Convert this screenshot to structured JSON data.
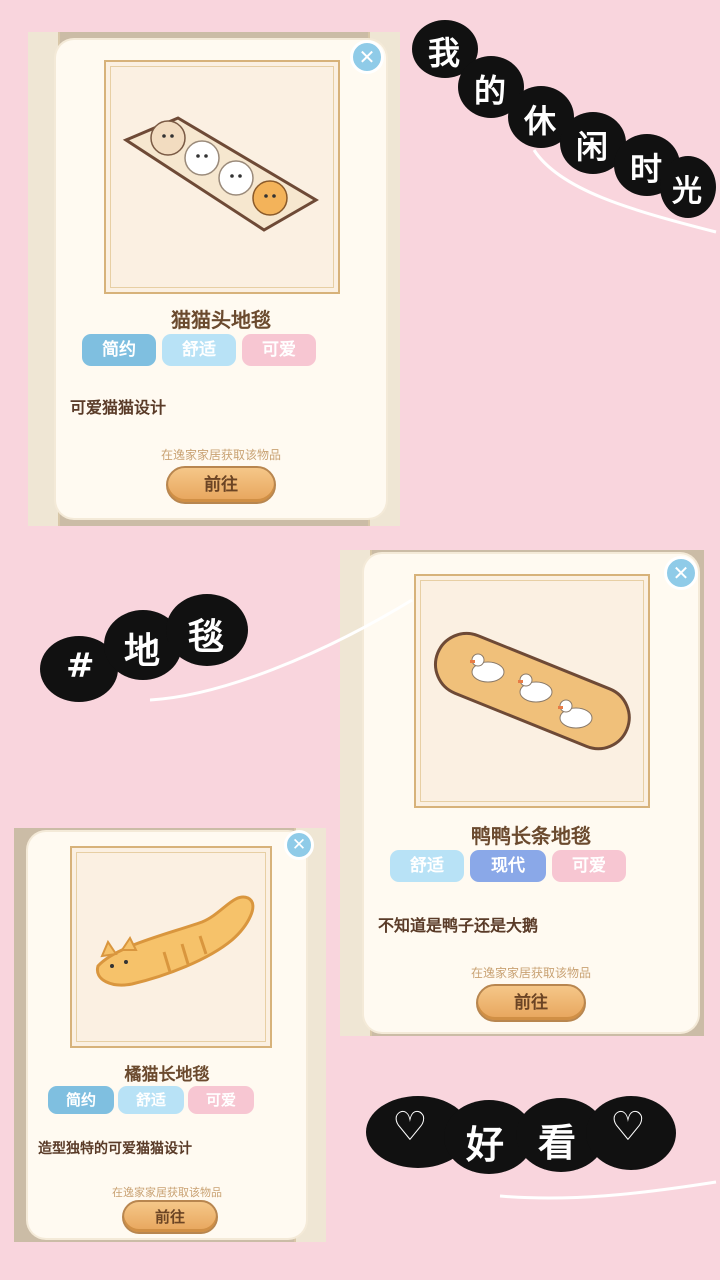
{
  "stickers": {
    "top_right": [
      "我",
      "的",
      "休",
      "闲",
      "时",
      "光"
    ],
    "hashtag": [
      "#",
      "地",
      "毯"
    ],
    "bottom": [
      "♡",
      "好",
      "看",
      "♡"
    ]
  },
  "cards": [
    {
      "name": "猫猫头地毯",
      "tags": [
        "简约",
        "舒适",
        "可爱"
      ],
      "description": "可爱猫猫设计",
      "source_hint": "在逸家家居获取该物品",
      "button_label": "前往",
      "close_icon": "close-icon"
    },
    {
      "name": "鸭鸭长条地毯",
      "tags": [
        "舒适",
        "现代",
        "可爱"
      ],
      "description": "不知道是鸭子还是大鹅",
      "source_hint": "在逸家家居获取该物品",
      "button_label": "前往",
      "close_icon": "close-icon"
    },
    {
      "name": "橘猫长地毯",
      "tags": [
        "简约",
        "舒适",
        "可爱"
      ],
      "description": "造型独特的可爱猫猫设计",
      "source_hint": "在逸家家居获取该物品",
      "button_label": "前往",
      "close_icon": "close-icon"
    }
  ],
  "colors": {
    "background": "#f9d5dd",
    "tag_blue": "#7fbfe0",
    "tag_light_blue": "#b8e2f6",
    "tag_pink": "#f7c6d2",
    "button": "#e7a55c",
    "close": "#8fcbe8"
  }
}
